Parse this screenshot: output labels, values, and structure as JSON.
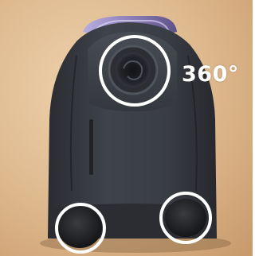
{
  "photo": {
    "subject": "vacuum-cleaner",
    "callouts": {
      "rotation_label": "360°",
      "highlight_color": "#ffffff"
    },
    "colors": {
      "background": "#d8b48a",
      "body": "#3a3d44",
      "handle_accent": "#8e7fb8"
    }
  }
}
